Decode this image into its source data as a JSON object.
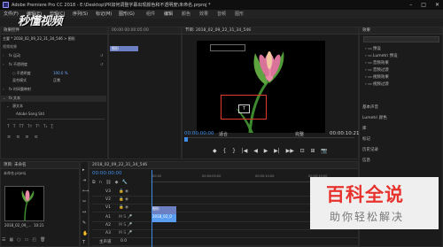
{
  "window": {
    "title": "Adobe Premiere Pro CC 2018 - E:\\Desktop\\PR如何调整字幕出现颜色和不透明度\\未命名.prproj *"
  },
  "menubar": {
    "items": [
      "文件(F)",
      "编辑(E)",
      "剪辑(C)",
      "序列(S)",
      "标记(M)",
      "图形(G)",
      "窗口(W)",
      "帮助(H)"
    ]
  },
  "workspace_tabs": [
    "组件",
    "编辑",
    "颜色",
    "效果",
    "音频",
    "图形"
  ],
  "effect_controls": {
    "tab_label": "效果控件",
    "source_line": "主要 * 2018_02_09_22_31_34_546 > 图形",
    "sub_header": "视频效果",
    "rows": [
      {
        "twirl": "›",
        "label": "fx 运动"
      },
      {
        "twirl": "›",
        "label": "fx 不透明度"
      },
      {
        "twirl": "",
        "label": "○ 不透明度",
        "value": "100.0 %"
      },
      {
        "twirl": "",
        "label": "混合模式",
        "value": "正常"
      },
      {
        "twirl": "›",
        "label": "fx 时间重映射"
      },
      {
        "twirl": "⌄",
        "label": "fx 文本"
      },
      {
        "twirl": "⌄",
        "label": "源文本"
      },
      {
        "twirl": "",
        "label": "Adobe Song Std"
      }
    ],
    "mini_timeline_label": "00:00 00:00:05:00",
    "clip_label": "图形"
  },
  "program_monitor": {
    "tab_label": "节目: 2018_02_09_22_31_34_546",
    "timecode_left": "00:00:00:00",
    "fit": "适合",
    "full": "完整",
    "timecode_right": "00:00:10:21",
    "text_box_symbol": "T",
    "controls": [
      "◆",
      "{",
      "}",
      "|◀",
      "◀",
      "▶",
      "▶|",
      "▶▶",
      "⊡",
      "⊞",
      "📷"
    ]
  },
  "right_panel": {
    "title": "效果",
    "items": [
      "预设",
      "Lumetri 预设",
      "音频效果",
      "音频过渡",
      "视频效果",
      "视频过渡"
    ],
    "sections": [
      "基本声音",
      "Lumetri 颜色",
      "库",
      "标记",
      "历史记录",
      "信息"
    ]
  },
  "project": {
    "tab_label": "项目: 未命名",
    "file_name": "未命名.prproj",
    "clip_name": "2018_02_09_...",
    "clip_duration": "10:21"
  },
  "timeline": {
    "tab_label": "2018_02_09_22_31_34_546",
    "timecode": "00:00:00:00",
    "ruler_labels": [
      "00:00",
      "00:00:05:00",
      "00:00:10:00",
      "00:00:15:00"
    ],
    "tracks": [
      {
        "name": "V3"
      },
      {
        "name": "V2"
      },
      {
        "name": "V1"
      },
      {
        "name": "A1"
      },
      {
        "name": "A2"
      },
      {
        "name": "A3"
      },
      {
        "name": "主声道",
        "value": "0.0"
      }
    ],
    "clip_v2": "图形",
    "clip_v1": "2018_02_0"
  },
  "watermark": {
    "top": "秒懂视频",
    "badge_title": "百科全说",
    "badge_sub": "助你轻松解决"
  },
  "colors": {
    "accent_blue": "#3f8ce8",
    "selection_red": "#e03a2c",
    "clip_purple": "#6b7fc2"
  }
}
